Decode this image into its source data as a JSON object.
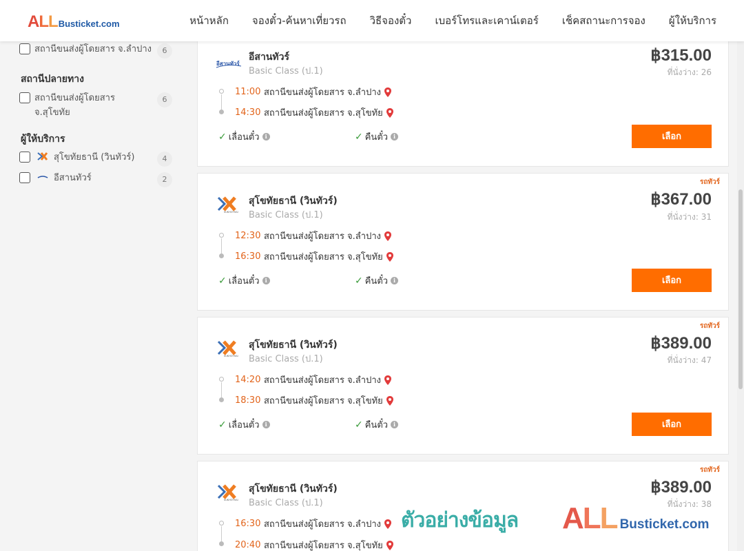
{
  "header": {
    "logo_all": "ALL",
    "logo_rest": "Busticket.com",
    "nav": [
      "หน้าหลัก",
      "จองตั๋ว-ค้นหาเที่ยวรถ",
      "วิธีจองตั๋ว",
      "เบอร์โทรและเคาน์เตอร์",
      "เช็คสถานะการจอง",
      "ผู้ให้บริการ"
    ]
  },
  "sidebar": {
    "origin_item": {
      "label": "สถานีขนส่งผู้โดยสาร จ.ลำปาง",
      "count": "6"
    },
    "destination_title": "สถานีปลายทาง",
    "destination_item": {
      "label_line1": "สถานีขนส่งผู้โดยสาร",
      "label_line2": "จ.สุโขทัย",
      "count": "6"
    },
    "operator_title": "ผู้ให้บริการ",
    "operators": [
      {
        "label": "สุโขทัยธานี (วินทัวร์)",
        "count": "4",
        "logo": "sukhothai-thani-logo"
      },
      {
        "label": "อีสานทัวร์",
        "count": "2",
        "logo": "isan-tour-logo"
      }
    ]
  },
  "trips": [
    {
      "operator": "อีสานทัวร์",
      "class": "Basic Class (ป.1)",
      "logo": "isan-tour-logo",
      "price": "฿315.00",
      "seats": "ที่นั่งว่าง: 26",
      "badge": "",
      "depart_time": "11:00",
      "depart_place": "สถานีขนส่งผู้โดยสาร จ.ลำปาง",
      "arrive_time": "14:30",
      "arrive_place": "สถานีขนส่งผู้โดยสาร จ.สุโขทัย",
      "policy1": "เลื่อนตั๋ว",
      "policy2": "คืนตั๋ว",
      "button": "เลือก"
    },
    {
      "operator": "สุโขทัยธานี (วินทัวร์)",
      "class": "Basic Class (ป.1)",
      "logo": "sukhothai-thani-logo",
      "price": "฿367.00",
      "seats": "ที่นั่งว่าง: 31",
      "badge": "รถทัวร์",
      "depart_time": "12:30",
      "depart_place": "สถานีขนส่งผู้โดยสาร จ.ลำปาง",
      "arrive_time": "16:30",
      "arrive_place": "สถานีขนส่งผู้โดยสาร จ.สุโขทัย",
      "policy1": "เลื่อนตั๋ว",
      "policy2": "คืนตั๋ว",
      "button": "เลือก"
    },
    {
      "operator": "สุโขทัยธานี (วินทัวร์)",
      "class": "Basic Class (ป.1)",
      "logo": "sukhothai-thani-logo",
      "price": "฿389.00",
      "seats": "ที่นั่งว่าง: 47",
      "badge": "รถทัวร์",
      "depart_time": "14:20",
      "depart_place": "สถานีขนส่งผู้โดยสาร จ.ลำปาง",
      "arrive_time": "18:30",
      "arrive_place": "สถานีขนส่งผู้โดยสาร จ.สุโขทัย",
      "policy1": "เลื่อนตั๋ว",
      "policy2": "คืนตั๋ว",
      "button": "เลือก"
    },
    {
      "operator": "สุโขทัยธานี (วินทัวร์)",
      "class": "Basic Class (ป.1)",
      "logo": "sukhothai-thani-logo",
      "price": "฿389.00",
      "seats": "ที่นั่งว่าง: 38",
      "badge": "รถทัวร์",
      "depart_time": "16:30",
      "depart_place": "สถานีขนส่งผู้โดยสาร จ.ลำปาง",
      "arrive_time": "20:40",
      "arrive_place": "สถานีขนส่งผู้โดยสาร จ.สุโขทัย",
      "policy1": "",
      "policy2": "",
      "button": ""
    }
  ],
  "watermark": {
    "text": "ตัวอย่างข้อมูล",
    "logo_all": "ALL",
    "logo_rest": "Busticket.com"
  },
  "colors": {
    "accent": "#ff6d00",
    "time": "#e2641b",
    "check": "#3a9b3a",
    "pin": "#e23b3b"
  }
}
